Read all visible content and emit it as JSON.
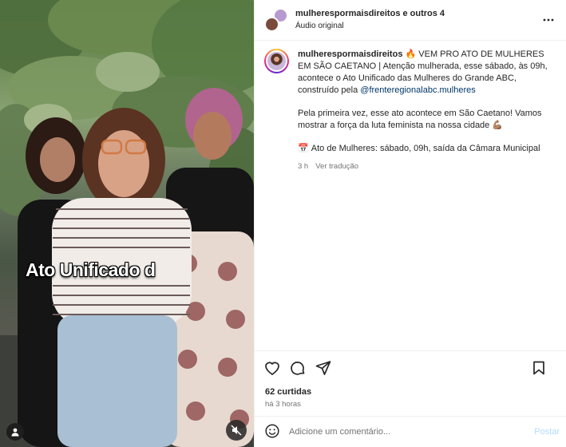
{
  "video": {
    "overlay_text": "Ato Unificado d",
    "mute_icon": "speaker-muted-icon",
    "profile_icon": "user-tag-icon"
  },
  "header": {
    "username": "mulherespormaisdireitos e outros 4",
    "audio": "Áudio original"
  },
  "caption": {
    "username": "mulherespormaisdireitos",
    "fire_emoji": "🔥",
    "line1": "VEM PRO ATO DE MULHERES EM SÃO CAETANO | Atenção mulherada, esse sábado, às 09h, acontece o Ato Unificado das Mulheres do Grande ABC, construído pela ",
    "mention": "@frenteregionalabc.mulheres",
    "para2": "Pela primeira vez, esse ato acontece em São Caetano! Vamos mostrar a força da luta feminista na nossa cidade 💪🏽",
    "calendar_emoji": "📅",
    "para3": "Ato de Mulheres: sábado, 09h, saída da Câmara Municipal",
    "age": "3 h",
    "translate": "Ver tradução"
  },
  "footer": {
    "likes": "62 curtidas",
    "time": "há 3 horas",
    "comment_placeholder": "Adicione um comentário...",
    "post_label": "Postar"
  },
  "colors": {
    "link": "#00376b",
    "muted": "#737373",
    "post_disabled": "#b3dbff"
  }
}
